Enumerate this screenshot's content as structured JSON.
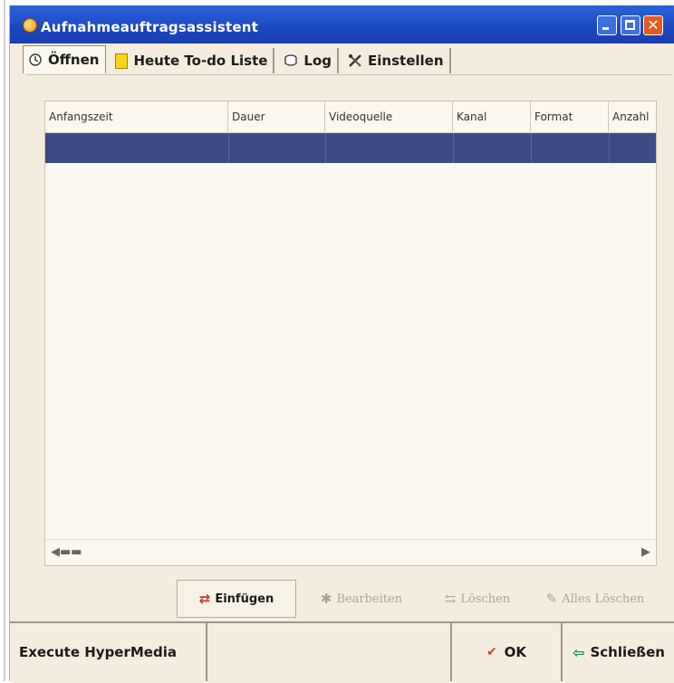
{
  "window": {
    "title": "Aufnahmeauftragsassistent",
    "close_glyph": "✕"
  },
  "tabs": [
    {
      "label": "Öffnen",
      "icon": "clock-icon"
    },
    {
      "label": "Heute To-do Liste",
      "icon": "note-icon"
    },
    {
      "label": "Log",
      "icon": "log-icon"
    },
    {
      "label": "Einstellen",
      "icon": "tools-icon"
    }
  ],
  "table": {
    "columns": [
      "Anfangszeit",
      "Dauer",
      "Videoquelle",
      "Kanal",
      "Format",
      "Anzahl"
    ],
    "rows": [
      {
        "selected": true,
        "cells": [
          "",
          "",
          "",
          "",
          "",
          ""
        ]
      }
    ]
  },
  "actions": {
    "insert_label": "Einfügen",
    "edit_label": "Bearbeiten",
    "delete_label": "Löschen",
    "delete_all_label": "Alles Löschen"
  },
  "statusbar": {
    "execute_label": "Execute HyperMedia",
    "ok_label": "OK",
    "close_label": "Schließen"
  },
  "colors": {
    "titlebar": "#1a47c0",
    "selection": "#3c4b86",
    "window_bg": "#f4eddf"
  }
}
